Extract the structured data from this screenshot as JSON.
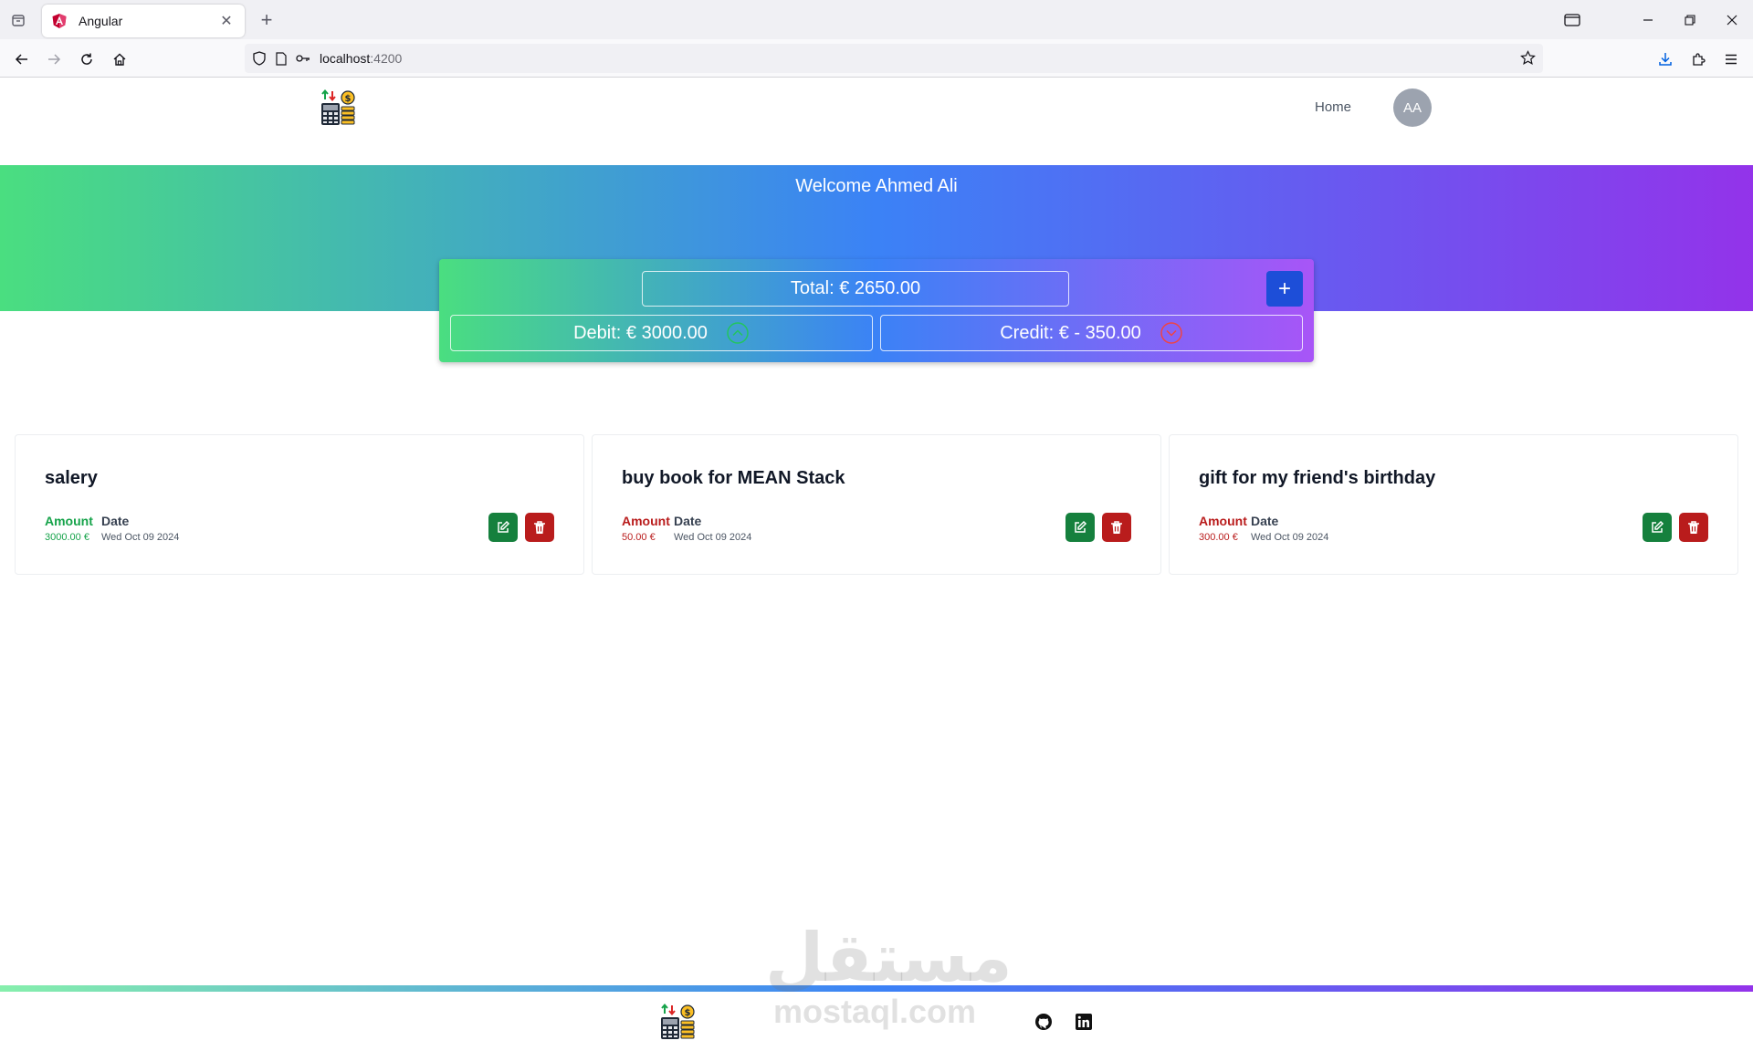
{
  "browser": {
    "tab_title": "Angular",
    "url_host": "localhost",
    "url_port": ":4200"
  },
  "header": {
    "nav_home": "Home",
    "avatar_initials": "AA"
  },
  "hero": {
    "welcome": "Welcome Ahmed Ali"
  },
  "summary": {
    "total": "Total: € 2650.00",
    "add_label": "+",
    "debit": "Debit: € 3000.00",
    "credit": "Credit: € - 350.00"
  },
  "transactions": [
    {
      "title": "salery",
      "amount_label": "Amount",
      "amount": "3000.00 €",
      "date_label": "Date",
      "date": "Wed Oct 09 2024",
      "type": "debit"
    },
    {
      "title": "buy book for MEAN Stack",
      "amount_label": "Amount",
      "amount": "50.00 €",
      "date_label": "Date",
      "date": "Wed Oct 09 2024",
      "type": "credit"
    },
    {
      "title": "gift for my friend's birthday",
      "amount_label": "Amount",
      "amount": "300.00 €",
      "date_label": "Date",
      "date": "Wed Oct 09 2024",
      "type": "credit"
    }
  ],
  "watermark": {
    "arabic": "مستقل",
    "latin": "mostaql.com"
  },
  "colors": {
    "debit": "#16a34a",
    "credit": "#b91c1c",
    "add_button": "#1d4ed8",
    "gradient_start": "#4ade80",
    "gradient_mid": "#3b82f6",
    "gradient_end": "#9333ea"
  },
  "icons": {
    "edit": "edit-icon",
    "delete": "trash-icon",
    "debit_indicator": "chevron-up-circle-icon",
    "credit_indicator": "chevron-down-circle-icon",
    "github": "github-icon",
    "linkedin": "linkedin-icon"
  }
}
